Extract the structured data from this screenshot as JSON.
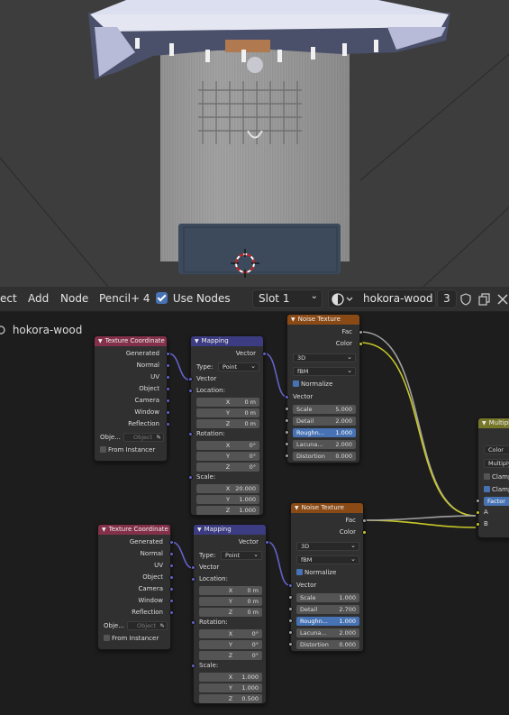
{
  "header": {
    "menu_object": "ect",
    "menu_add": "Add",
    "menu_node": "Node",
    "menu_pencil": "Pencil+ 4",
    "use_nodes_label": "Use Nodes",
    "slot": "Slot 1",
    "material_name": "hokora-wood",
    "user_count": "3"
  },
  "breadcrumb": {
    "material": "hokora-wood"
  },
  "icons": [
    "material-sphere-icon",
    "shield-icon",
    "copy-icon",
    "close-icon",
    "eyedropper-icon",
    "chevron-down-icon"
  ],
  "colors": {
    "texture_coordinate_header": "#83314a",
    "mapping_header": "#3c3c83",
    "noise_texture_header": "#8a4a16",
    "mix_header": "#77772a",
    "vector_socket": "#6363c7",
    "color_socket": "#c7c729",
    "float_socket": "#a1a1a1",
    "highlight": "#4772b3"
  },
  "nodes": {
    "tc1": {
      "title": "Texture Coordinate",
      "outputs": [
        "Generated",
        "Normal",
        "UV",
        "Object",
        "Camera",
        "Window",
        "Reflection"
      ],
      "object_label": "Obje...",
      "object_placeholder": "Object",
      "from_instancer": "From Instancer"
    },
    "tc2": {
      "title": "Texture Coordinate",
      "outputs": [
        "Generated",
        "Normal",
        "UV",
        "Object",
        "Camera",
        "Window",
        "Reflection"
      ],
      "object_label": "Obje...",
      "object_placeholder": "Object",
      "from_instancer": "From Instancer"
    },
    "map1": {
      "title": "Mapping",
      "out": "Vector",
      "type_label": "Type:",
      "type_value": "Point",
      "vector_in": "Vector",
      "location": "Location:",
      "loc": {
        "x": "0 m",
        "y": "0 m",
        "z": "0 m"
      },
      "rotation": "Rotation:",
      "rot": {
        "x": "0°",
        "y": "0°",
        "z": "0°"
      },
      "scale_label": "Scale:",
      "scale": {
        "x": "20.000",
        "y": "1.000",
        "z": "1.000"
      },
      "axis": {
        "x": "X",
        "y": "Y",
        "z": "Z"
      }
    },
    "map2": {
      "title": "Mapping",
      "out": "Vector",
      "type_label": "Type:",
      "type_value": "Point",
      "vector_in": "Vector",
      "location": "Location:",
      "loc": {
        "x": "0 m",
        "y": "0 m",
        "z": "0 m"
      },
      "rotation": "Rotation:",
      "rot": {
        "x": "0°",
        "y": "0°",
        "z": "0°"
      },
      "scale_label": "Scale:",
      "scale": {
        "x": "1.000",
        "y": "1.000",
        "z": "0.500"
      },
      "axis": {
        "x": "X",
        "y": "Y",
        "z": "Z"
      }
    },
    "noise1": {
      "title": "Noise Texture",
      "fac": "Fac",
      "color": "Color",
      "dim": "3D",
      "noise_type": "fBM",
      "normalize": "Normalize",
      "vector_in": "Vector",
      "scale_label": "Scale",
      "scale": "5.000",
      "detail_label": "Detail",
      "detail": "2.000",
      "roughness_label": "Roughn...",
      "roughness": "1.000",
      "lacunarity_label": "Lacuna...",
      "lacunarity": "2.000",
      "distortion_label": "Distortion",
      "distortion": "0.000"
    },
    "noise2": {
      "title": "Noise Texture",
      "fac": "Fac",
      "color": "Color",
      "dim": "3D",
      "noise_type": "fBM",
      "normalize": "Normalize",
      "vector_in": "Vector",
      "scale_label": "Scale",
      "scale": "1.000",
      "detail_label": "Detail",
      "detail": "2.700",
      "roughness_label": "Roughn...",
      "roughness": "1.000",
      "lacunarity_label": "Lacuna...",
      "lacunarity": "2.000",
      "distortion_label": "Distortion",
      "distortion": "0.000"
    },
    "mix": {
      "title": "Multipl",
      "data_type": "Color",
      "blend": "Multiply",
      "clamp_result": "Clamp",
      "clamp_factor": "Clamp",
      "factor": "Factor",
      "a": "A",
      "b": "B"
    }
  }
}
